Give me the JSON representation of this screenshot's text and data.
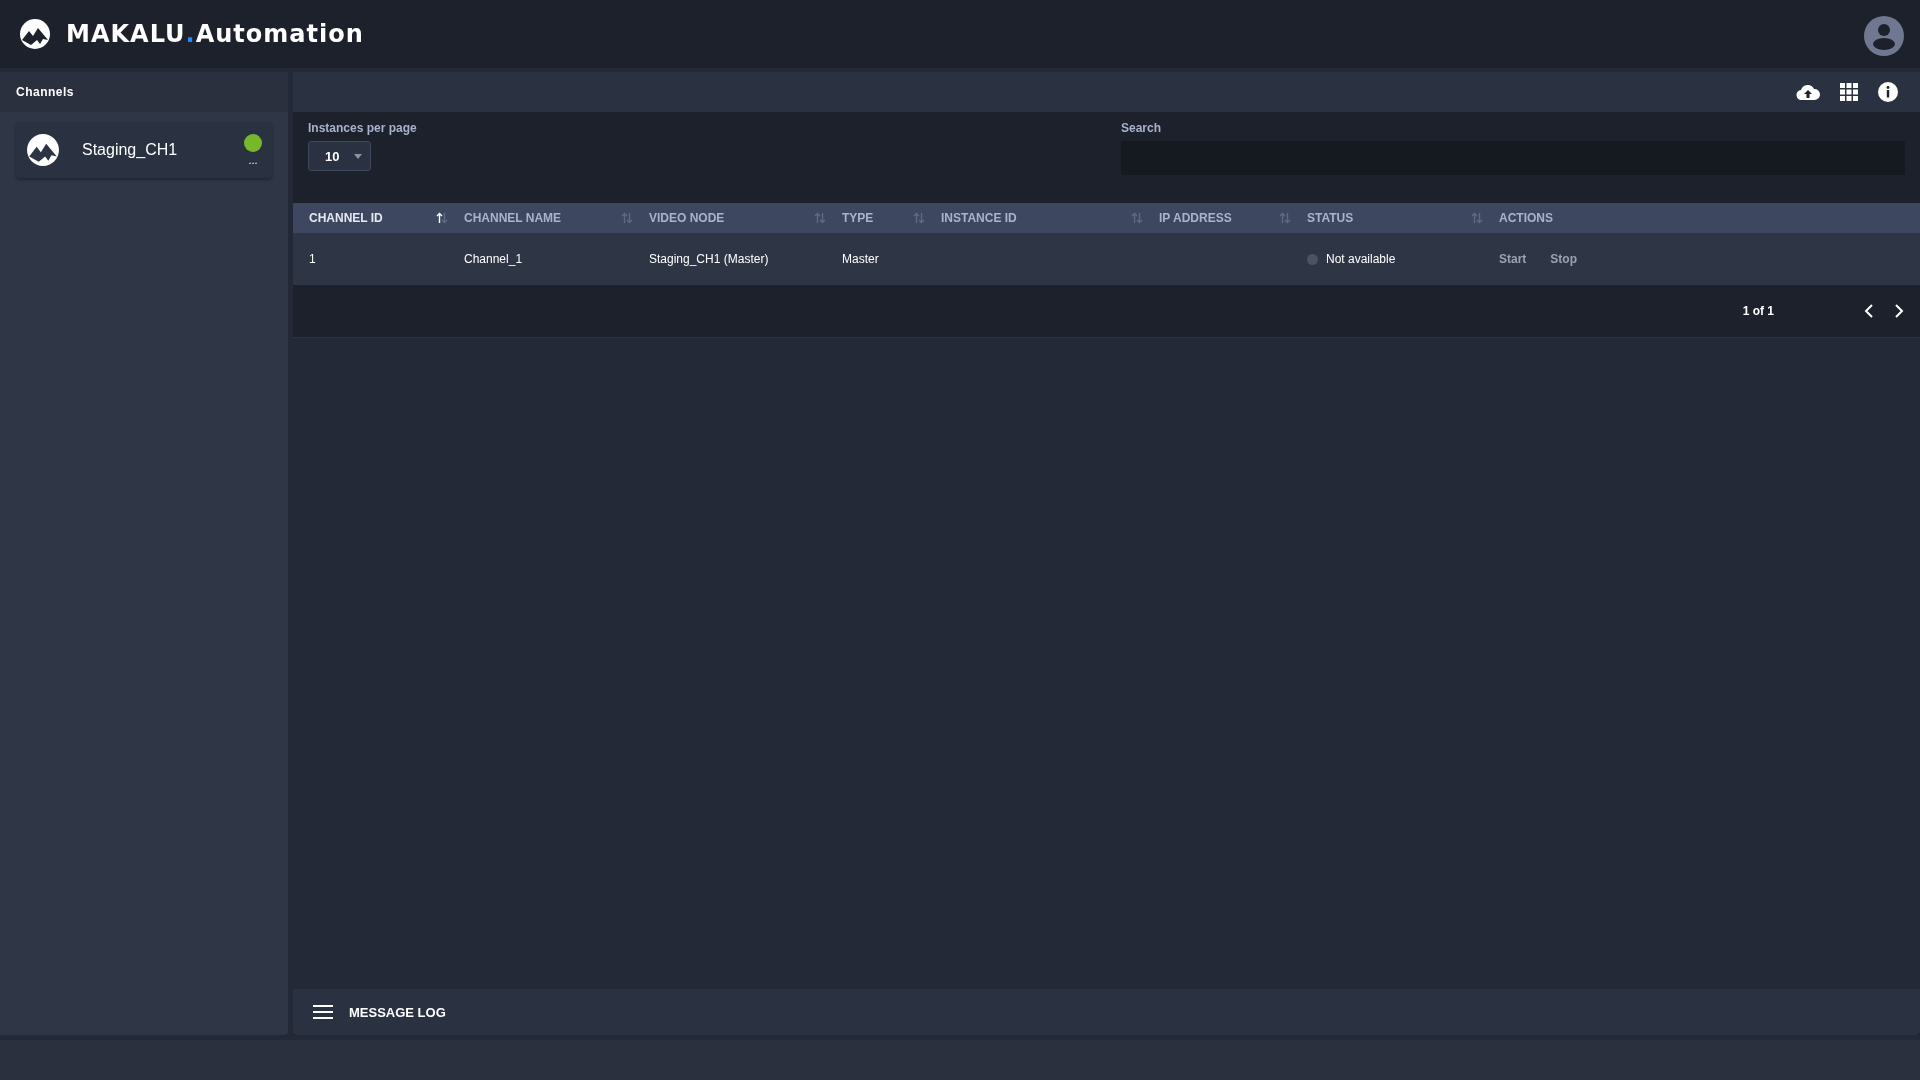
{
  "header": {
    "brand": "MAKALU",
    "brand_separator": ".",
    "brand_suffix": "Automation"
  },
  "sidebar": {
    "title": "Channels",
    "channels": [
      {
        "name": "Staging_CH1",
        "color": "#76b82a",
        "more": "..."
      }
    ]
  },
  "filters": {
    "per_page_label": "Instances per page",
    "per_page_value": "10",
    "search_label": "Search"
  },
  "table": {
    "columns": [
      {
        "label": "CHANNEL ID",
        "sortable": true,
        "sorted": true
      },
      {
        "label": "CHANNEL NAME",
        "sortable": true,
        "sorted": false
      },
      {
        "label": "VIDEO NODE",
        "sortable": true,
        "sorted": false
      },
      {
        "label": "TYPE",
        "sortable": true,
        "sorted": false
      },
      {
        "label": "INSTANCE ID",
        "sortable": true,
        "sorted": false
      },
      {
        "label": "IP ADDRESS",
        "sortable": true,
        "sorted": false
      },
      {
        "label": "STATUS",
        "sortable": true,
        "sorted": false
      },
      {
        "label": "ACTIONS",
        "sortable": false,
        "sorted": false
      }
    ],
    "rows": [
      {
        "channel_id": "1",
        "channel_name": "Channel_1",
        "video_node": "Staging_CH1 (Master)",
        "type": "Master",
        "status": "Not available",
        "color": "#4a5366",
        "actions": [
          "Start",
          "Stop"
        ]
      }
    ]
  },
  "pagination": {
    "text": "1 of 1"
  },
  "message_log": {
    "label": "MESSAGE LOG"
  }
}
